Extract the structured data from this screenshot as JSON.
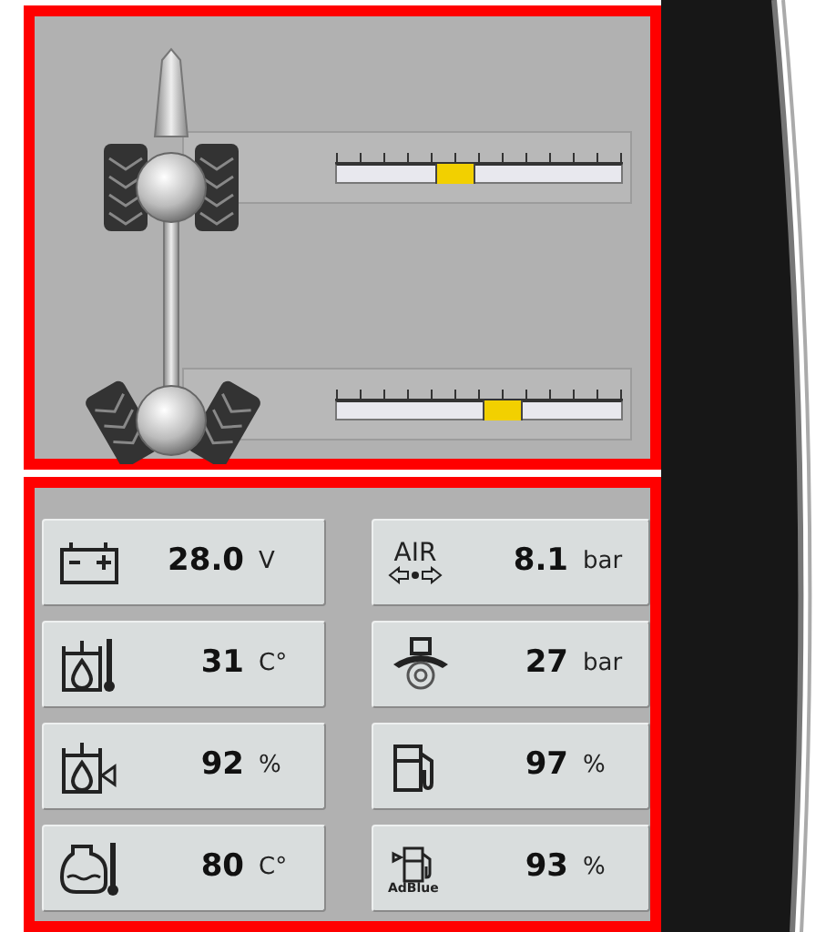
{
  "steering": [
    {
      "level": 0.42
    },
    {
      "level": 0.58
    }
  ],
  "readings": [
    {
      "kind": "battery",
      "value": "28.0",
      "unit": "V"
    },
    {
      "kind": "air",
      "icon_text": "AIR",
      "value": "8.1",
      "unit": "bar"
    },
    {
      "kind": "oil-temp",
      "value": "31",
      "unit": "C°"
    },
    {
      "kind": "brake",
      "value": "27",
      "unit": "bar"
    },
    {
      "kind": "oil-level",
      "value": "92",
      "unit": "%"
    },
    {
      "kind": "fuel",
      "value": "97",
      "unit": "%"
    },
    {
      "kind": "coolant",
      "value": "80",
      "unit": "C°"
    },
    {
      "kind": "adblue",
      "icon_text": "AdBlue",
      "value": "93",
      "unit": "%"
    }
  ]
}
